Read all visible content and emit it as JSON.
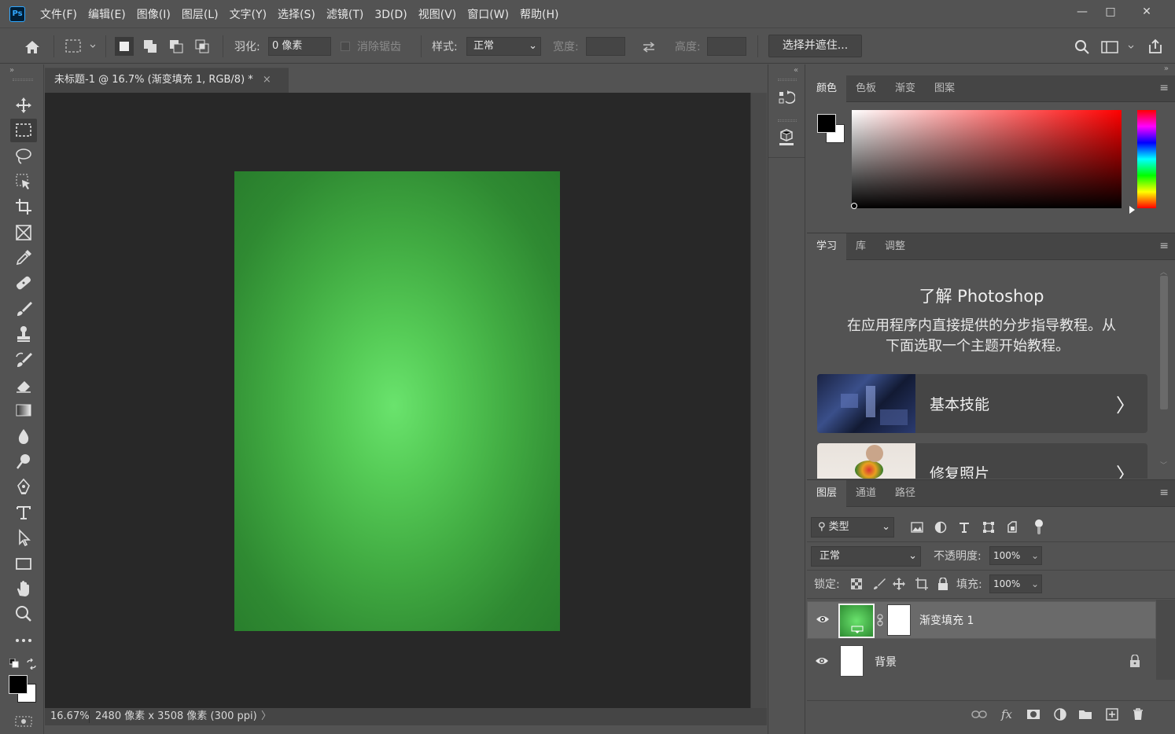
{
  "app": {
    "logo_text": "Ps"
  },
  "menu": [
    "文件(F)",
    "编辑(E)",
    "图像(I)",
    "图层(L)",
    "文字(Y)",
    "选择(S)",
    "滤镜(T)",
    "3D(D)",
    "视图(V)",
    "窗口(W)",
    "帮助(H)"
  ],
  "window_controls": {
    "minimize": "—",
    "maximize": "□",
    "close": "✕"
  },
  "options": {
    "feather_label": "羽化:",
    "feather_value": "0 像素",
    "antialias_label": "消除锯齿",
    "style_label": "样式:",
    "style_value": "正常",
    "width_label": "宽度:",
    "height_label": "高度:",
    "select_mask_label": "选择并遮住..."
  },
  "document": {
    "tab_title": "未标题-1 @ 16.7% (渐变填充 1, RGB/8) *",
    "close_glyph": "×",
    "zoom": "16.67%",
    "info": "2480 像素 x 3508 像素 (300 ppi)",
    "canvas_gradient": {
      "center": "#6ae36d",
      "edge": "#287c2c"
    }
  },
  "color_panel": {
    "tabs": [
      "颜色",
      "色板",
      "渐变",
      "图案"
    ],
    "foreground": "#000000",
    "background": "#ffffff",
    "hue": "#ff0000"
  },
  "learn_panel": {
    "tabs": [
      "学习",
      "库",
      "调整"
    ],
    "heading": "了解 Photoshop",
    "description_line1": "在应用程序内直接提供的分步指导教程。从",
    "description_line2": "下面选取一个主题开始教程。",
    "cards": [
      {
        "title": "基本技能"
      },
      {
        "title": "修复照片"
      }
    ]
  },
  "layers_panel": {
    "tabs": [
      "图层",
      "通道",
      "路径"
    ],
    "filter_kind": "类型",
    "blend_mode": "正常",
    "opacity_label": "不透明度:",
    "opacity_value": "100%",
    "lock_label": "锁定:",
    "fill_label": "填充:",
    "fill_value": "100%",
    "layers": [
      {
        "name": "渐变填充 1",
        "selected": true
      },
      {
        "name": "背景",
        "selected": false,
        "locked": true
      }
    ]
  }
}
